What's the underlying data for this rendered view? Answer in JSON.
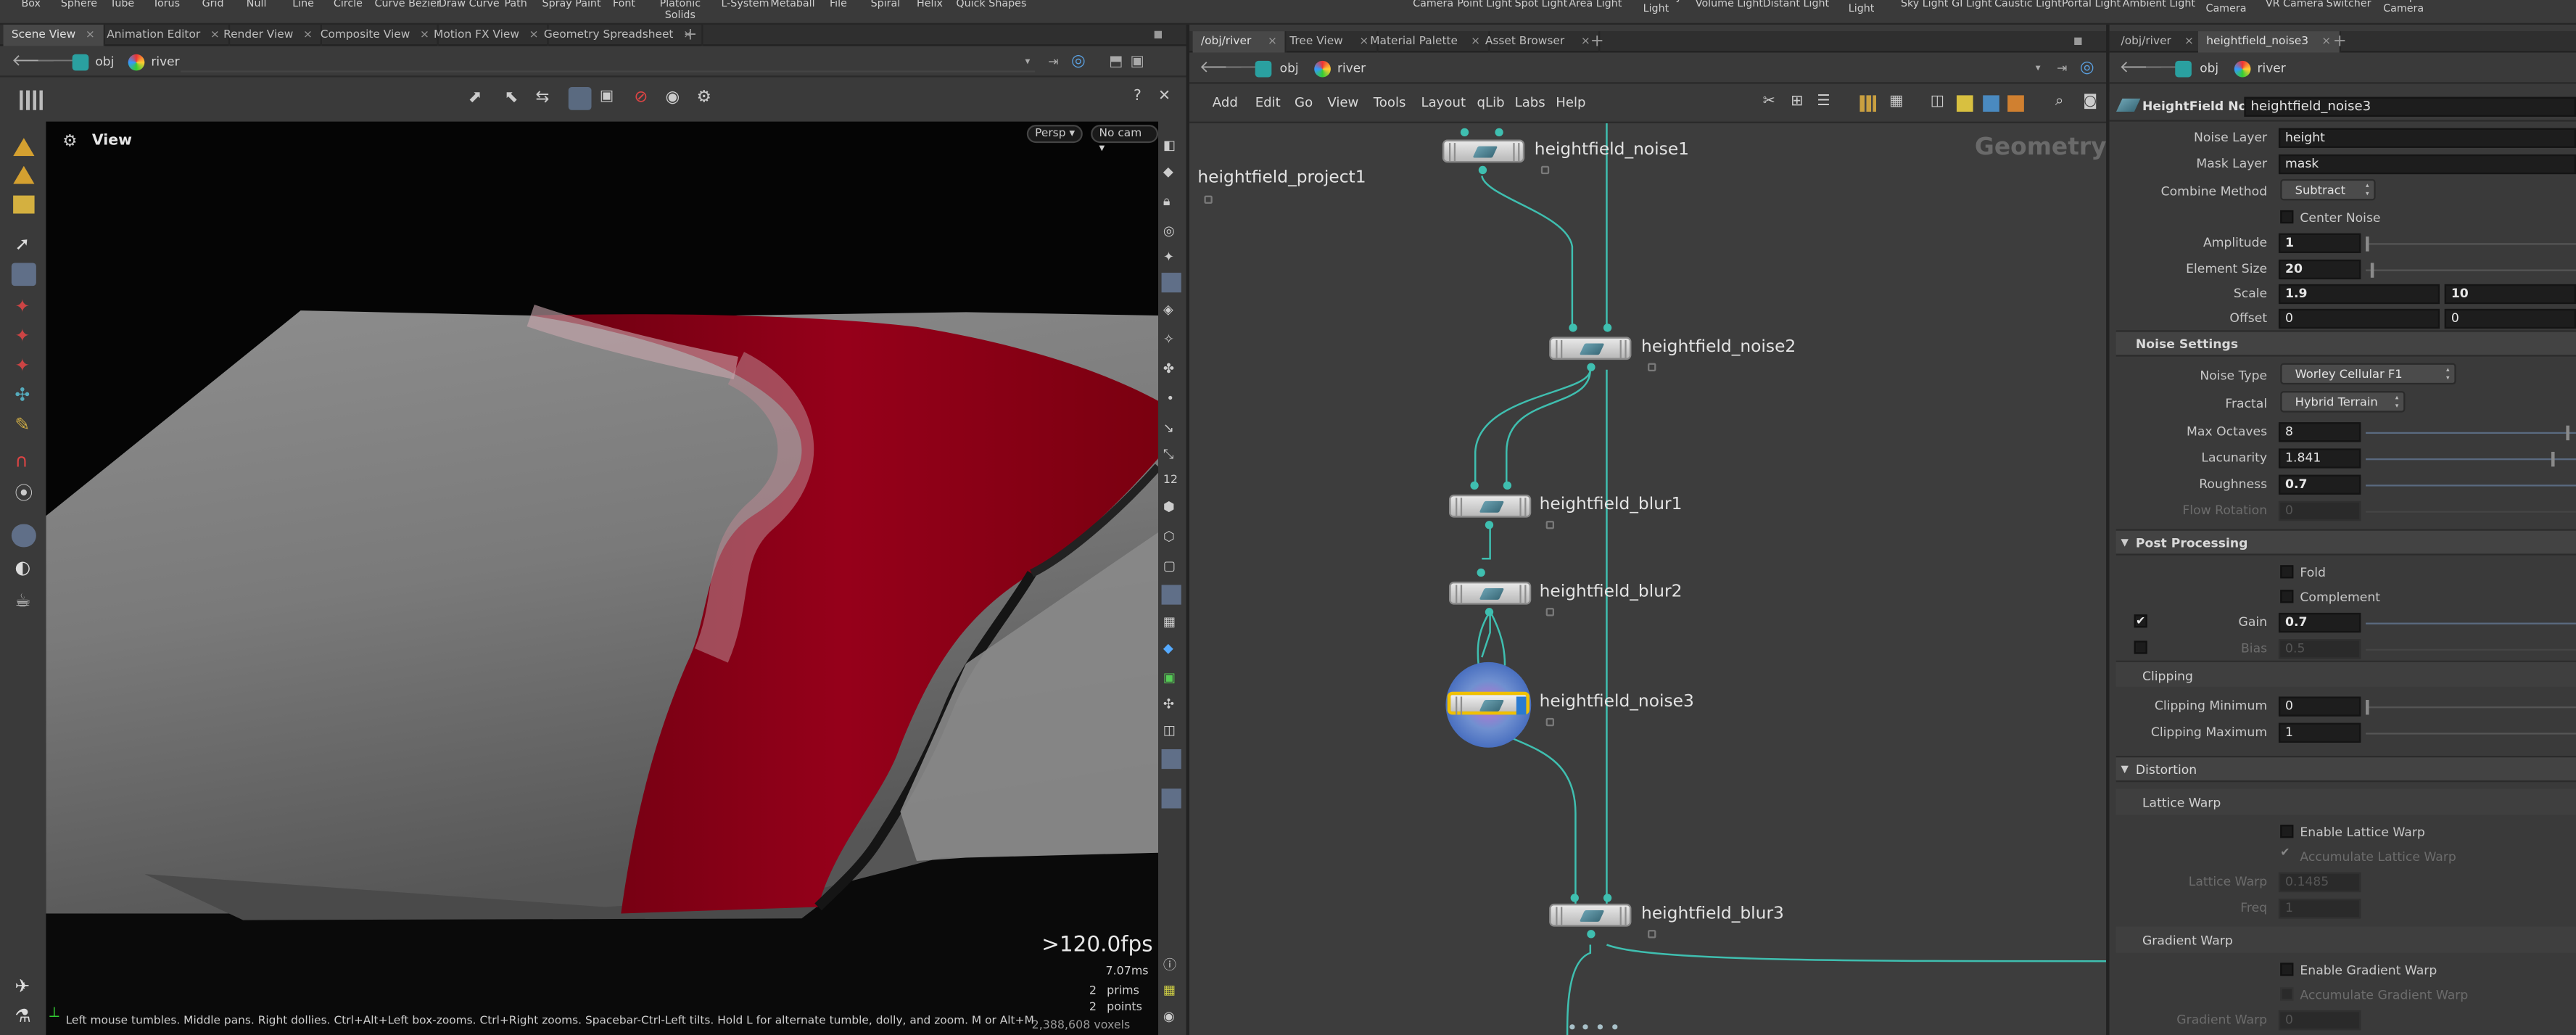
{
  "shelf": {
    "tools": [
      "Box",
      "Sphere",
      "Tube",
      "Torus",
      "Grid",
      "Null",
      "Line",
      "Circle",
      "Curve Bezier",
      "Draw Curve",
      "Path",
      "Spray Paint",
      "Font",
      "Platonic Solids",
      "L-System",
      "Metaball",
      "File",
      "Spiral",
      "Helix",
      "Quick Shapes"
    ],
    "lights": [
      "Camera",
      "Point Light",
      "Spot Light",
      "Area Light",
      "Geometry Light",
      "Volume Light",
      "Distant Light",
      "Environment Light",
      "Sky Light",
      "GI Light",
      "Caustic Light",
      "Portal Light",
      "Ambient Light",
      "Stereo Camera",
      "VR Camera",
      "Switcher",
      "Gamepad Camera"
    ]
  },
  "left": {
    "tabs": [
      "Scene View",
      "Animation Editor",
      "Render View",
      "Composite View",
      "Motion FX View",
      "Geometry Spreadsheet"
    ],
    "path_context": "obj",
    "path_node": "river",
    "view_label": "View",
    "persp_btn": "Persp",
    "cam_btn": "No cam",
    "fps": ">120.0fps",
    "time_ms": "7.07ms",
    "stats": [
      {
        "value": "2",
        "label": "prims"
      },
      {
        "value": "2",
        "label": "points"
      },
      {
        "value": "2,388,608",
        "label": "voxels"
      }
    ],
    "status_text": "Left mouse tumbles. Middle pans. Right dollies. Ctrl+Alt+Left box-zooms. Ctrl+Right zooms. Spacebar-Ctrl-Left tilts. Hold L for alternate tumble, dolly, and zoom. M or Alt+M for First"
  },
  "network": {
    "tabs": [
      "/obj/river",
      "Tree View",
      "Material Palette",
      "Asset Browser"
    ],
    "path_context": "obj",
    "path_node": "river",
    "menu": [
      "Add",
      "Edit",
      "Go",
      "View",
      "Tools",
      "Layout",
      "qLib",
      "Labs",
      "Help"
    ],
    "context_label": "Geometry",
    "nodes": {
      "project1": "heightfield_project1",
      "noise1": "heightfield_noise1",
      "noise2": "heightfield_noise2",
      "blur1": "heightfield_blur1",
      "blur2": "heightfield_blur2",
      "noise3": "heightfield_noise3",
      "blur3": "heightfield_blur3"
    }
  },
  "params": {
    "tabs": [
      "/obj/river",
      "heightfield_noise3"
    ],
    "path_context": "obj",
    "path_node": "river",
    "node_type": "HeightField Noise",
    "node_name": "heightfield_noise3",
    "noise_layer": {
      "label": "Noise Layer",
      "value": "height"
    },
    "mask_layer": {
      "label": "Mask Layer",
      "value": "mask"
    },
    "combine_method": {
      "label": "Combine Method",
      "value": "Subtract"
    },
    "center_noise": "Center Noise",
    "amplitude": {
      "label": "Amplitude",
      "value": "1"
    },
    "element_size": {
      "label": "Element Size",
      "value": "20"
    },
    "scale": {
      "label": "Scale",
      "x": "1.9",
      "y": "10"
    },
    "offset": {
      "label": "Offset",
      "x": "0",
      "y": "0"
    },
    "noise_settings": "Noise Settings",
    "noise_type": {
      "label": "Noise Type",
      "value": "Worley Cellular F1"
    },
    "fractal": {
      "label": "Fractal",
      "value": "Hybrid Terrain"
    },
    "max_octaves": {
      "label": "Max Octaves",
      "value": "8"
    },
    "lacunarity": {
      "label": "Lacunarity",
      "value": "1.841"
    },
    "roughness": {
      "label": "Roughness",
      "value": "0.7"
    },
    "flow_rotation": {
      "label": "Flow Rotation",
      "value": "0"
    },
    "post_processing": "Post Processing",
    "fold": "Fold",
    "complement": "Complement",
    "gain": {
      "label": "Gain",
      "value": "0.7"
    },
    "bias": {
      "label": "Bias",
      "value": "0.5"
    },
    "clipping": "Clipping",
    "clip_min": {
      "label": "Clipping Minimum",
      "value": "0"
    },
    "clip_max": {
      "label": "Clipping Maximum",
      "value": "1"
    },
    "distortion": "Distortion",
    "lattice_warp": "Lattice Warp",
    "enable_lattice": "Enable Lattice Warp",
    "accumulate_lattice": "Accumulate Lattice Warp",
    "lattice_warp_parm": {
      "label": "Lattice Warp",
      "value": "0.1485"
    },
    "freq": {
      "label": "Freq",
      "value": "1"
    },
    "gradient_warp": "Gradient Warp",
    "enable_gradient": "Enable Gradient Warp",
    "accumulate_gradient": "Accumulate Gradient Warp",
    "gradient_warp_parm": {
      "label": "Gradient Warp",
      "value": "0"
    }
  },
  "colors": {
    "accent_teal": "#3fbfb0",
    "selection_yellow": "#f0c000",
    "river_red": "#8a0010"
  }
}
